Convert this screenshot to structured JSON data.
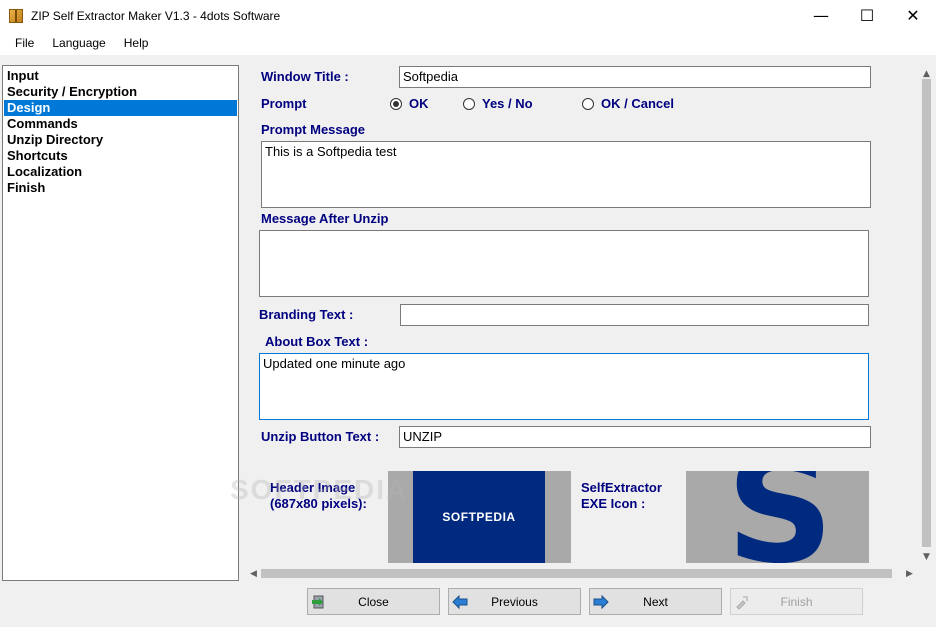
{
  "window": {
    "title": "ZIP Self Extractor Maker V1.3 - 4dots Software",
    "minimize": "—",
    "maximize": "☐",
    "close": "✕"
  },
  "menu": {
    "items": [
      "File",
      "Language",
      "Help"
    ]
  },
  "nav": {
    "items": [
      {
        "label": "Input"
      },
      {
        "label": "Security / Encryption"
      },
      {
        "label": "Design",
        "selected": true
      },
      {
        "label": "Commands"
      },
      {
        "label": "Unzip Directory"
      },
      {
        "label": "Shortcuts"
      },
      {
        "label": "Localization"
      },
      {
        "label": "Finish"
      }
    ]
  },
  "form": {
    "window_title_label": "Window Title :",
    "window_title_value": "Softpedia",
    "prompt_label": "Prompt",
    "prompt_options": [
      {
        "label": "OK",
        "checked": true
      },
      {
        "label": "Yes / No",
        "checked": false
      },
      {
        "label": "OK / Cancel",
        "checked": false
      }
    ],
    "prompt_message_label": "Prompt Message",
    "prompt_message_value": "This is a Softpedia test",
    "message_after_unzip_label": "Message After Unzip",
    "message_after_unzip_value": "",
    "branding_text_label": "Branding Text :",
    "branding_text_value": "",
    "about_box_text_label": "About Box Text :",
    "about_box_text_value": "Updated one minute ago",
    "unzip_button_text_label": "Unzip Button Text :",
    "unzip_button_text_value": "UNZIP",
    "header_image_label_1": "Header Image",
    "header_image_label_2": "(687x80 pixels):",
    "header_image_logo_text": "SOFTPEDIA",
    "exe_icon_label_1": "SelfExtractor",
    "exe_icon_label_2": "EXE Icon :",
    "exe_icon_glyph": "S"
  },
  "watermark": "SOFTPEDIA",
  "buttons": {
    "close": "Close",
    "previous": "Previous",
    "next": "Next",
    "finish": "Finish"
  },
  "colors": {
    "label": "#000080",
    "selection": "#0078d7",
    "logo_blue": "#002a7f"
  }
}
